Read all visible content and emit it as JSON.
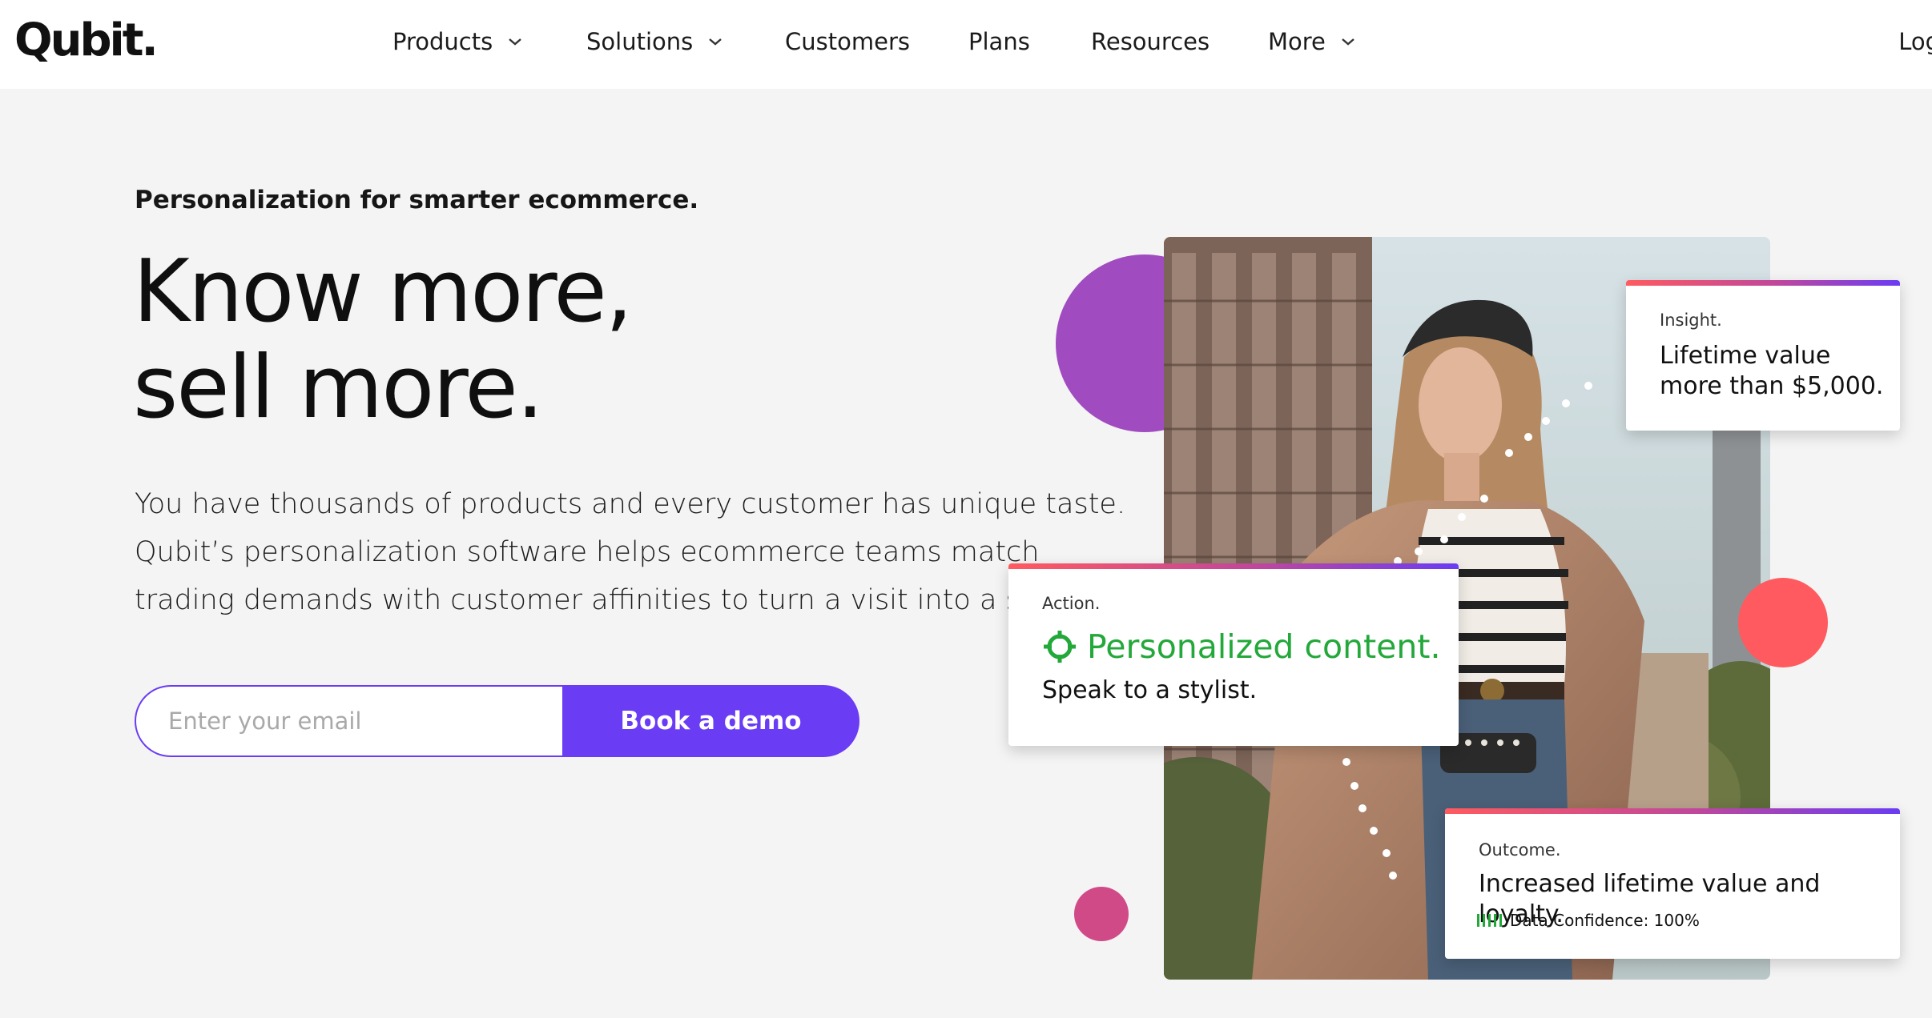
{
  "brand": {
    "logo_text": "Qubit."
  },
  "nav": {
    "items": [
      {
        "label": "Products",
        "has_dropdown": true
      },
      {
        "label": "Solutions",
        "has_dropdown": true
      },
      {
        "label": "Customers",
        "has_dropdown": false
      },
      {
        "label": "Plans",
        "has_dropdown": false
      },
      {
        "label": "Resources",
        "has_dropdown": false
      },
      {
        "label": "More",
        "has_dropdown": true
      }
    ],
    "login_label": "Log"
  },
  "hero": {
    "tagline": "Personalization for smarter ecommerce.",
    "headline": [
      "Know more,",
      "sell more."
    ],
    "body": [
      "You have thousands of products and every customer has unique taste.",
      "Qubit’s personalization software helps ecommerce teams match",
      "trading demands with customer affinities to turn a visit into a sale."
    ],
    "email_placeholder": "Enter your email",
    "cta_label": "Book a demo"
  },
  "cards": {
    "insight": {
      "label": "Insight.",
      "text": [
        "Lifetime value",
        "more than $5,000."
      ]
    },
    "action": {
      "label": "Action.",
      "title": "Personalized content.",
      "text": "Speak to a stylist."
    },
    "outcome": {
      "label": "Outcome.",
      "text": "Increased lifetime value and loyalty.",
      "confidence": "Data Confidence: 100%"
    }
  },
  "colors": {
    "accent": "#6a3cf4",
    "purple_circle": "#a04cc0",
    "coral_circle": "#ff5a5f",
    "pink_circle": "#d14a88",
    "success_green": "#23a83a"
  }
}
